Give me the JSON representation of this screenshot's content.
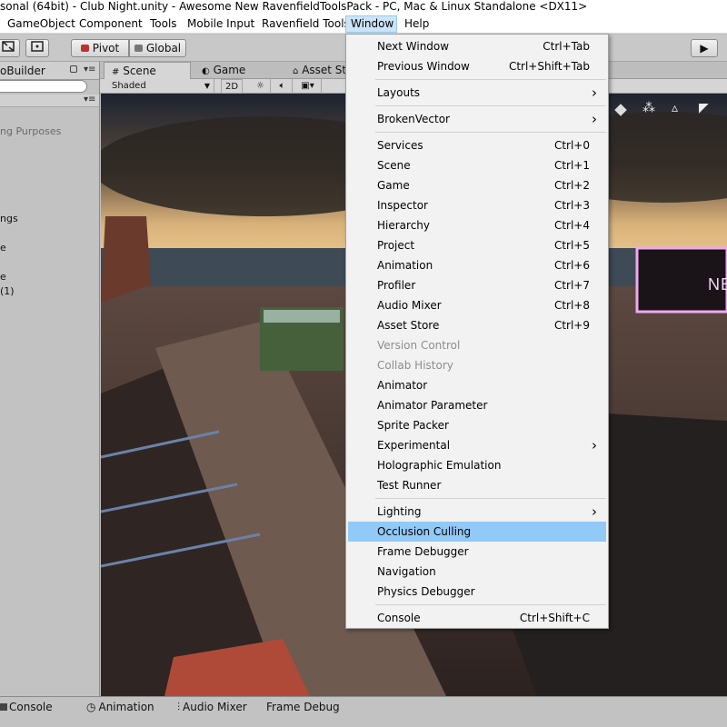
{
  "window": {
    "title": "sonal (64bit) - Club Night.unity - Awesome New RavenfieldToolsPack - PC, Mac & Linux Standalone <DX11>"
  },
  "menubar": {
    "items": [
      "GameObject",
      "Component",
      "Tools",
      "Mobile Input",
      "Ravenfield Tools",
      "Window",
      "Help"
    ],
    "open": "Window"
  },
  "toolbar": {
    "pivot": "Pivot",
    "global": "Global",
    "play": "▶"
  },
  "hierarchy": {
    "tab": "oBuilder",
    "rows": [
      "ng Purposes",
      "ngs",
      "e",
      "e",
      " (1)"
    ]
  },
  "scene": {
    "tabs": [
      "Scene",
      "Game",
      "Asset St"
    ],
    "shading": "Shaded",
    "mode_2d": "2D",
    "sign_text": "NE"
  },
  "bottom_tabs": [
    "Console",
    "Animation",
    "Audio Mixer",
    "Frame Debug"
  ],
  "window_menu": {
    "groups": [
      [
        {
          "label": "Next Window",
          "shortcut": "Ctrl+Tab"
        },
        {
          "label": "Previous Window",
          "shortcut": "Ctrl+Shift+Tab"
        }
      ],
      [
        {
          "label": "Layouts",
          "submenu": true
        }
      ],
      [
        {
          "label": "BrokenVector",
          "submenu": true
        }
      ],
      [
        {
          "label": "Services",
          "shortcut": "Ctrl+0"
        },
        {
          "label": "Scene",
          "shortcut": "Ctrl+1"
        },
        {
          "label": "Game",
          "shortcut": "Ctrl+2"
        },
        {
          "label": "Inspector",
          "shortcut": "Ctrl+3"
        },
        {
          "label": "Hierarchy",
          "shortcut": "Ctrl+4"
        },
        {
          "label": "Project",
          "shortcut": "Ctrl+5"
        },
        {
          "label": "Animation",
          "shortcut": "Ctrl+6"
        },
        {
          "label": "Profiler",
          "shortcut": "Ctrl+7"
        },
        {
          "label": "Audio Mixer",
          "shortcut": "Ctrl+8"
        },
        {
          "label": "Asset Store",
          "shortcut": "Ctrl+9"
        },
        {
          "label": "Version Control",
          "disabled": true
        },
        {
          "label": "Collab History",
          "disabled": true
        },
        {
          "label": "Animator"
        },
        {
          "label": "Animator Parameter"
        },
        {
          "label": "Sprite Packer"
        },
        {
          "label": "Experimental",
          "submenu": true
        },
        {
          "label": "Holographic Emulation"
        },
        {
          "label": "Test Runner"
        }
      ],
      [
        {
          "label": "Lighting",
          "submenu": true
        },
        {
          "label": "Occlusion Culling",
          "highlighted": true
        },
        {
          "label": "Frame Debugger"
        },
        {
          "label": "Navigation"
        },
        {
          "label": "Physics Debugger"
        }
      ],
      [
        {
          "label": "Console",
          "shortcut": "Ctrl+Shift+C"
        }
      ]
    ]
  },
  "colors": {
    "menu_highlight": "#91c9f7",
    "menubar_open": "#cce4f7",
    "editor_gray": "#c2c2c2",
    "sign_pink": "#f0a8f0"
  }
}
